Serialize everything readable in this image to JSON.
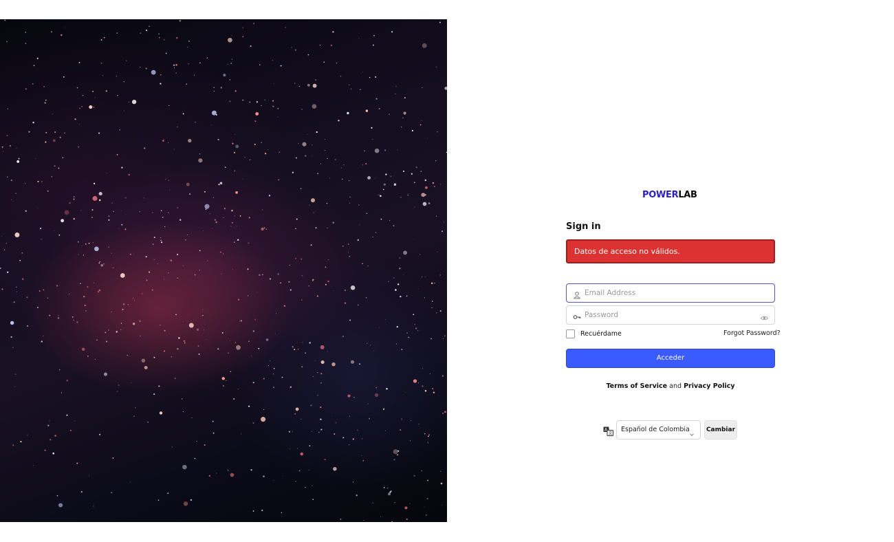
{
  "logo": {
    "part1": "POWER",
    "part2": "LAB"
  },
  "form": {
    "title": "Sign in",
    "error_message": "Datos de acceso no válidos.",
    "email": {
      "placeholder": "Email Address",
      "value": "",
      "icon": "user-icon"
    },
    "password": {
      "placeholder": "Password",
      "value": "",
      "icon": "key-icon",
      "toggle_icon": "eye-icon"
    },
    "remember_label": "Recuérdame",
    "remember_checked": false,
    "forgot_label": "Forgot Password?",
    "submit_label": "Acceder"
  },
  "legal": {
    "terms_label": "Terms of Service",
    "and_label": "and",
    "privacy_label": "Privacy Policy"
  },
  "language": {
    "icon": "translate-icon",
    "selected": "Español de Colombia",
    "change_label": "Cambiar"
  },
  "colors": {
    "brand": "#2a1fc7",
    "error": "#dc3232",
    "primary": "#3a5bff"
  }
}
